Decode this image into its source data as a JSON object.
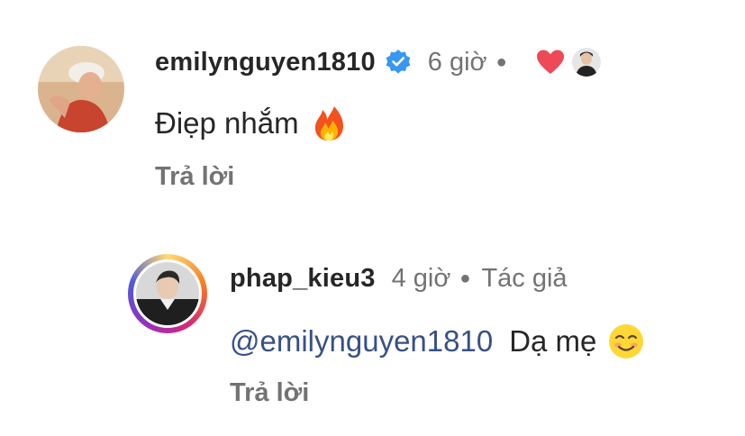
{
  "comments": [
    {
      "username": "emilynguyen1810",
      "time": "6 giờ",
      "text": "Điẹp nhắm",
      "reply_label": "Trả lời",
      "verified": true,
      "liked_by_author": true
    },
    {
      "username": "phap_kieu3",
      "time": "4 giờ",
      "author_badge": "Tác giả",
      "mention": "@emilynguyen1810",
      "text": "Dạ mẹ",
      "reply_label": "Trả lời"
    }
  ],
  "colors": {
    "mention": "#385185",
    "verified": "#3897f0",
    "heart": "#ed4956",
    "muted": "#737373"
  },
  "icons": [
    "verified-badge-icon",
    "heart-icon",
    "fire-emoji-icon",
    "smiling-emoji-icon"
  ]
}
